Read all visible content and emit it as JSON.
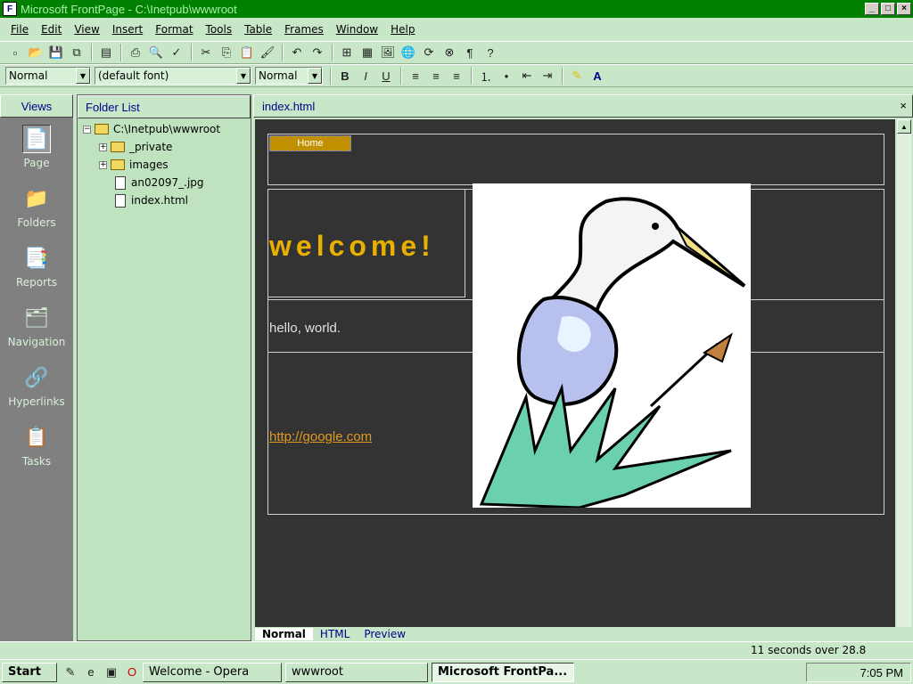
{
  "window": {
    "title": "Microsoft FrontPage - C:\\Inetpub\\wwwroot"
  },
  "menubar": {
    "items": [
      "File",
      "Edit",
      "View",
      "Insert",
      "Format",
      "Tools",
      "Table",
      "Frames",
      "Window",
      "Help"
    ]
  },
  "toolbar2": {
    "style": "Normal",
    "font": "(default font)",
    "size": "Normal"
  },
  "views": {
    "header": "Views",
    "items": [
      {
        "label": "Page",
        "icon": "page-view-icon"
      },
      {
        "label": "Folders",
        "icon": "folder-view-icon"
      },
      {
        "label": "Reports",
        "icon": "reports-view-icon"
      },
      {
        "label": "Navigation",
        "icon": "navigation-view-icon"
      },
      {
        "label": "Hyperlinks",
        "icon": "hyperlinks-view-icon"
      },
      {
        "label": "Tasks",
        "icon": "tasks-view-icon"
      }
    ]
  },
  "folders": {
    "header": "Folder List",
    "root": "C:\\Inetpub\\wwwroot",
    "items": [
      "_private",
      "images",
      "an02097_.jpg",
      "index.html"
    ]
  },
  "editor": {
    "tab": "index.html",
    "home_button": "Home",
    "welcome": "welcome!",
    "hello": "hello, world.",
    "link": "http://google.com",
    "bottom_tabs": [
      "Normal",
      "HTML",
      "Preview"
    ]
  },
  "status": {
    "text": "11 seconds over 28.8"
  },
  "taskbar": {
    "start": "Start",
    "tasks": [
      "Welcome - Opera",
      "wwwroot",
      "Microsoft FrontPa..."
    ],
    "clock": "7:05 PM"
  },
  "colors": {
    "titlebar": "#008000",
    "chrome": "#c8e6c8",
    "canvas": "#333333",
    "welcome": "#e8b000",
    "link": "#e09820"
  }
}
